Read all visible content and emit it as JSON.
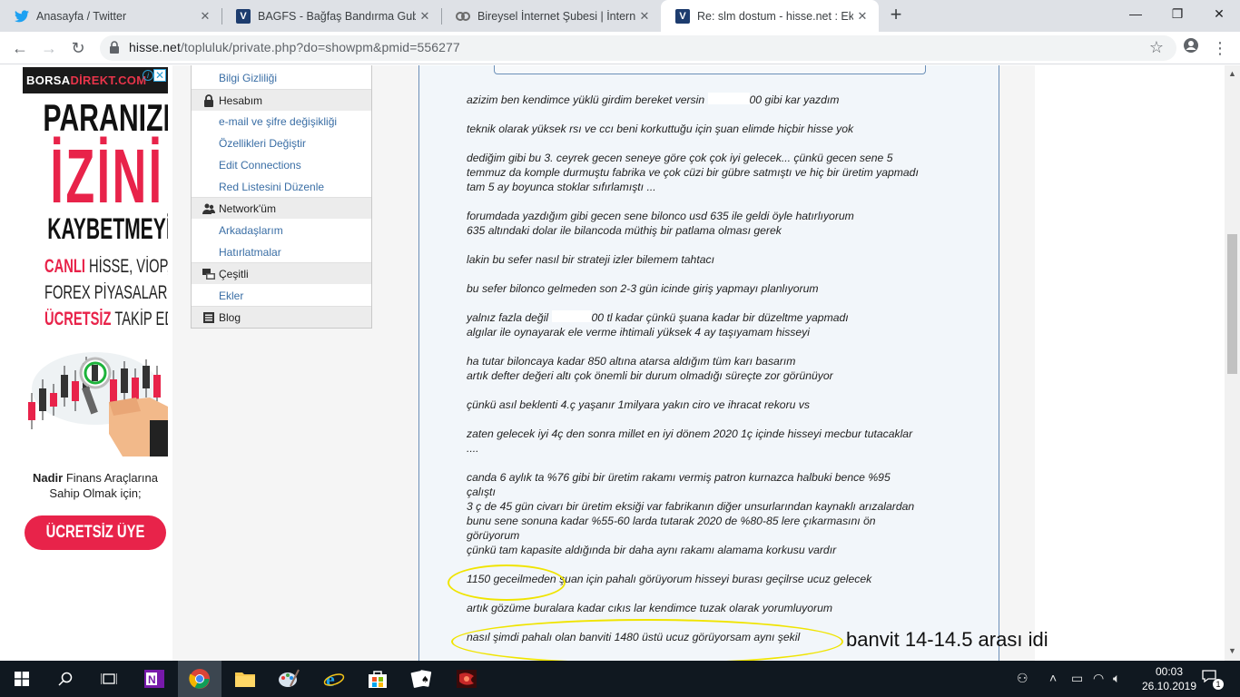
{
  "browser": {
    "tabs": [
      {
        "title": "Anasayfa / Twitter",
        "icon": "twitter-bird-icon"
      },
      {
        "title": "BAGFS - Bağfaş Bandırma Gubre",
        "icon": "hisse-net-icon"
      },
      {
        "title": "Bireysel İnternet Şubesi | İnternet",
        "icon": "bank-icon"
      },
      {
        "title": "Re: slm dostum - hisse.net : Ekon",
        "icon": "hisse-net-icon"
      }
    ],
    "active_tab": 3,
    "url_host": "hisse.net",
    "url_path": "/topluluk/private.php?do=showpm&pmid=556277",
    "favicon_letter": "V"
  },
  "ad": {
    "brand_a": "BORSA",
    "brand_b": "DİREKT.COM",
    "line1": "PARANIZIN",
    "line2": "İZİNİ",
    "line3": "KAYBETMEYİN!",
    "line4_a": "CANLI",
    "line4_b": " HİSSE, VİOP,",
    "line5": "FOREX PİYASALARINI",
    "line6_a": "ÜCRETSİZ",
    "line6_b": " TAKİP EDİN.",
    "line7_a": "Nadir",
    "line7_b": " Finans Araçlarına",
    "line8": "Sahip Olmak için;",
    "button": "ÜCRETSİZ ÜYE OL!",
    "accent": "#e8234a"
  },
  "sidebar": {
    "items": [
      {
        "label": "Bilgi Gizliliği",
        "type": "link"
      },
      {
        "label": "Hesabım",
        "type": "header",
        "icon": "lock-icon"
      },
      {
        "label": "e-mail ve şifre değişikliği",
        "type": "link"
      },
      {
        "label": "Özellikleri Değiştir",
        "type": "link"
      },
      {
        "label": "Edit Connections",
        "type": "link"
      },
      {
        "label": "Red Listesini Düzenle",
        "type": "link"
      },
      {
        "label": "Network'üm",
        "type": "header",
        "icon": "users-icon"
      },
      {
        "label": "Arkadaşlarım",
        "type": "link"
      },
      {
        "label": "Hatırlatmalar",
        "type": "link"
      },
      {
        "label": "Çeşitli",
        "type": "header",
        "icon": "misc-icon"
      },
      {
        "label": "Ekler",
        "type": "link"
      },
      {
        "label": "Blog",
        "type": "header",
        "icon": "blog-icon"
      }
    ]
  },
  "message": {
    "lines": [
      {
        "pre": "azizim ben kendimce yüklü girdim bereket versin ",
        "post": "00 gibi kar yazdım",
        "masked": true
      },
      {
        "text": "teknik olarak yüksek rsı ve ccı beni korkuttuğu için şuan elimde hiçbir hisse yok"
      },
      {
        "text": "dediğim gibi bu 3. ceyrek gecen seneye göre çok çok iyi gelecek... çünkü gecen sene 5"
      },
      {
        "text": "temmuz da komple durmuştu fabrika ve çok cüzi bir gübre satmıştı ve hiç bir üretim yapmadı"
      },
      {
        "text": "tam 5 ay boyunca stoklar sıfırlamıştı ..."
      },
      {
        "text": "forumdada yazdığım gibi gecen sene bilonco usd 635 ile geldi öyle hatırlıyorum"
      },
      {
        "text": "635 altındaki dolar ile bilancoda müthiş bir patlama olması gerek"
      },
      {
        "text": "lakin bu sefer nasıl bir strateji izler bilemem tahtacı"
      },
      {
        "text": "bu sefer bilonco gelmeden son 2-3 gün icinde giriş yapmayı planlıyorum"
      },
      {
        "pre": "yalnız fazla değil ",
        "post": "00 tl kadar çünkü şuana kadar bir düzeltme yapmadı",
        "masked": true
      },
      {
        "text": "algılar ile oynayarak ele verme ihtimali yüksek 4 ay taşıyamam hisseyi"
      },
      {
        "text": "ha tutar biloncaya kadar 850 altına atarsa aldığım tüm karı basarım"
      },
      {
        "text": "artık defter değeri altı çok önemli bir durum olmadığı süreçte zor görünüyor"
      },
      {
        "text": "çünkü asıl beklenti 4.ç yaşanır 1milyara yakın ciro ve ihracat rekoru vs"
      },
      {
        "text": "zaten gelecek iyi 4ç den sonra millet en iyi dönem 2020 1ç içinde hisseyi mecbur tutacaklar"
      },
      {
        "text": "...."
      },
      {
        "text": "canda 6 aylık ta %76 gibi bir üretim rakamı vermiş patron kurnazca halbuki bence %95"
      },
      {
        "text": "çalıştı"
      },
      {
        "text": "3 ç de 45 gün civarı bir üretim eksiği var fabrikanın diğer unsurlarından kaynaklı arızalardan"
      },
      {
        "text": "bunu sene sonuna kadar %55-60 larda tutarak 2020 de %80-85 lere çıkarmasını ön"
      },
      {
        "text": "görüyorum"
      },
      {
        "text": "çünkü tam kapasite aldığında bir daha aynı rakamı alamama korkusu vardır"
      },
      {
        "text": "1150 geceilmeden şuan için pahalı görüyorum hisseyi burası geçilrse ucuz gelecek"
      },
      {
        "text": "artık gözüme buralara kadar cıkıs lar kendimce tuzak olarak yorumluyorum"
      },
      {
        "text": "nasıl şimdi pahalı olan banviti 1480 üstü ucuz görüyorsam aynı şekil"
      }
    ],
    "annotation": "banvit 14-14.5 arası idi",
    "highlight_color": "#f0e400"
  },
  "taskbar": {
    "apps": [
      "start-icon",
      "search-icon",
      "task-view-icon",
      "onenote-icon",
      "chrome-icon",
      "file-explorer-icon",
      "paint-icon",
      "internet-explorer-icon",
      "store-icon",
      "solitaire-icon",
      "game-icon"
    ],
    "time": "00:03",
    "date": "26.10.2019",
    "notification_count": "1"
  }
}
